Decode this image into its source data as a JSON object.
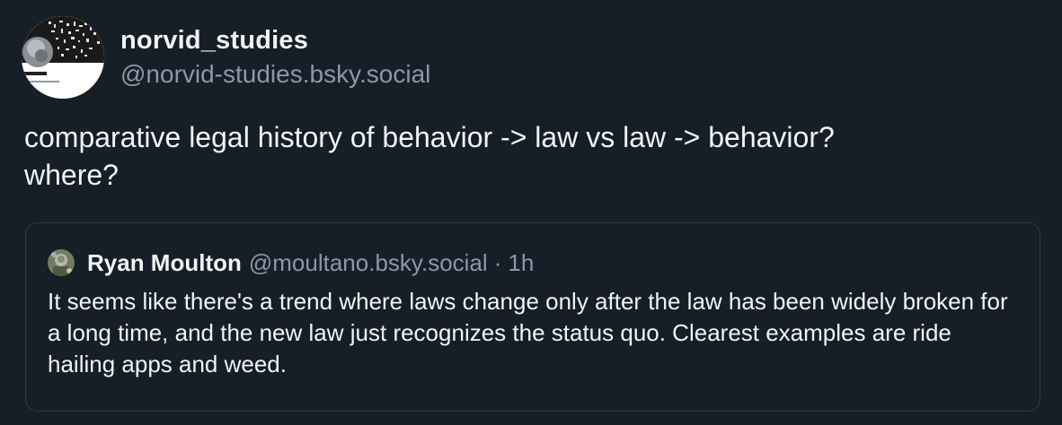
{
  "post": {
    "author": {
      "display_name": "norvid_studies",
      "handle": "@norvid-studies.bsky.social"
    },
    "text": "comparative legal history of behavior -> law vs law -> behavior?\nwhere?"
  },
  "quote": {
    "author": {
      "display_name": "Ryan Moulton",
      "handle": "@moultano.bsky.social"
    },
    "separator": "·",
    "time": "1h",
    "text": "It seems like there's a trend where laws change only after the law has been widely broken for a long time, and the new law just recognizes the status quo. Clearest examples are ride hailing apps and weed."
  },
  "colors": {
    "background": "#161e27",
    "text_primary": "#f1f3f5",
    "text_secondary": "#8b98a9",
    "border": "#2e3a47"
  }
}
